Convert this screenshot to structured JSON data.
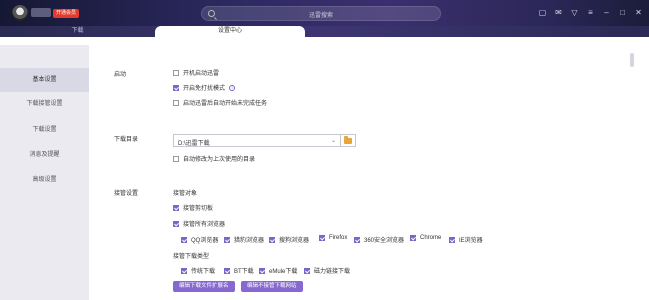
{
  "titlebar": {
    "vip_badge": "开通会员",
    "search_placeholder": "迅雷搜索",
    "icons": [
      "skin-icon",
      "message-icon",
      "settings-icon",
      "menu-icon",
      "minimize-icon",
      "maximize-icon",
      "close-icon"
    ]
  },
  "tabs": {
    "download": "下载",
    "settings": "设置中心"
  },
  "sidebar": {
    "items": [
      {
        "label": "基本设置",
        "active": true
      },
      {
        "label": "下载接管设置",
        "active": false
      },
      {
        "label": "下载设置",
        "active": false
      },
      {
        "label": "消息及提醒",
        "active": false
      },
      {
        "label": "高级设置",
        "active": false
      }
    ]
  },
  "startup": {
    "label": "启动",
    "options": [
      {
        "label": "开机启动迅雷",
        "checked": false
      },
      {
        "label": "开启免打扰模式",
        "checked": true
      },
      {
        "label": "启动迅雷后自动开始未完成任务",
        "checked": false
      }
    ]
  },
  "download_dir": {
    "label": "下载目录",
    "value": "D:\\迅雷下载",
    "option": {
      "label": "自动修改为上次使用的目录",
      "checked": false
    }
  },
  "takeover": {
    "label": "接管设置",
    "targets_head": "接管对象",
    "clipboard": {
      "label": "接管剪切板",
      "checked": true
    },
    "all_browsers": {
      "label": "接管所有浏览器",
      "checked": true
    },
    "browsers": [
      {
        "label": "QQ浏览器",
        "checked": true
      },
      {
        "label": "猎豹浏览器",
        "checked": true
      },
      {
        "label": "搜狗浏览器",
        "checked": true
      },
      {
        "label": "Firefox",
        "checked": true
      },
      {
        "label": "360安全浏览器",
        "checked": true
      },
      {
        "label": "Chrome",
        "checked": true
      },
      {
        "label": "IE浏览器",
        "checked": true
      }
    ],
    "types_head": "接管下载类型",
    "types": [
      {
        "label": "传统下载",
        "checked": true
      },
      {
        "label": "BT下载",
        "checked": true
      },
      {
        "label": "eMule下载",
        "checked": true
      },
      {
        "label": "磁力链接下载",
        "checked": true
      }
    ],
    "btn_extensions": "编辑下载文件扩展名",
    "btn_no_takeover": "编辑不接管下载网站"
  },
  "colors": {
    "accent": "#7d64c8",
    "vip": "#e23a2c",
    "folder": "#e9a53a"
  }
}
